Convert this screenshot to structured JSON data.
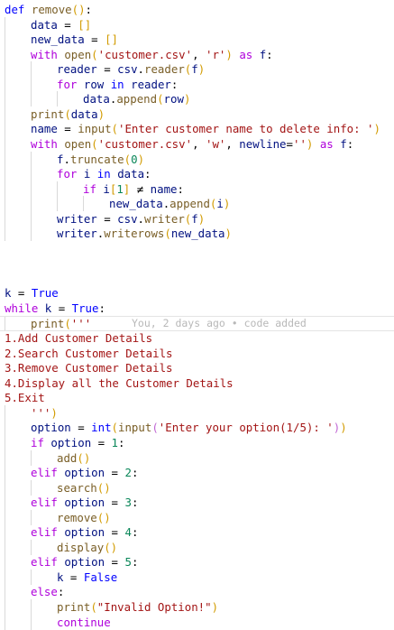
{
  "editor": {
    "blame_text": "You, 2 days ago • code added",
    "lines": [
      {
        "indent": 0,
        "tokens": [
          [
            "kw",
            "def"
          ],
          [
            "op",
            " "
          ],
          [
            "fn",
            "remove"
          ],
          [
            "br1",
            "()"
          ],
          [
            "op",
            ":"
          ]
        ]
      },
      {
        "indent": 1,
        "tokens": [
          [
            "var",
            "data"
          ],
          [
            "op",
            " = "
          ],
          [
            "br1",
            "[]"
          ]
        ]
      },
      {
        "indent": 1,
        "tokens": [
          [
            "var",
            "new_data"
          ],
          [
            "op",
            " = "
          ],
          [
            "br1",
            "[]"
          ]
        ]
      },
      {
        "indent": 1,
        "tokens": [
          [
            "ctl",
            "with"
          ],
          [
            "op",
            " "
          ],
          [
            "fn",
            "open"
          ],
          [
            "br1",
            "("
          ],
          [
            "str",
            "'customer.csv'"
          ],
          [
            "op",
            ", "
          ],
          [
            "str",
            "'r'"
          ],
          [
            "br1",
            ")"
          ],
          [
            "op",
            " "
          ],
          [
            "ctl",
            "as"
          ],
          [
            "op",
            " "
          ],
          [
            "var",
            "f"
          ],
          [
            "op",
            ":"
          ]
        ]
      },
      {
        "indent": 2,
        "tokens": [
          [
            "var",
            "reader"
          ],
          [
            "op",
            " = "
          ],
          [
            "var",
            "csv"
          ],
          [
            "op",
            "."
          ],
          [
            "fn",
            "reader"
          ],
          [
            "br1",
            "("
          ],
          [
            "var",
            "f"
          ],
          [
            "br1",
            ")"
          ]
        ]
      },
      {
        "indent": 2,
        "tokens": [
          [
            "ctl",
            "for"
          ],
          [
            "op",
            " "
          ],
          [
            "var",
            "row"
          ],
          [
            "op",
            " "
          ],
          [
            "kw",
            "in"
          ],
          [
            "op",
            " "
          ],
          [
            "var",
            "reader"
          ],
          [
            "op",
            ":"
          ]
        ]
      },
      {
        "indent": 3,
        "tokens": [
          [
            "var",
            "data"
          ],
          [
            "op",
            "."
          ],
          [
            "fn",
            "append"
          ],
          [
            "br1",
            "("
          ],
          [
            "var",
            "row"
          ],
          [
            "br1",
            ")"
          ]
        ]
      },
      {
        "indent": 1,
        "tokens": [
          [
            "fn",
            "print"
          ],
          [
            "br1",
            "("
          ],
          [
            "var",
            "data"
          ],
          [
            "br1",
            ")"
          ]
        ]
      },
      {
        "indent": 1,
        "tokens": [
          [
            "var",
            "name"
          ],
          [
            "op",
            " = "
          ],
          [
            "fn",
            "input"
          ],
          [
            "br1",
            "("
          ],
          [
            "str",
            "'Enter customer name to delete info: '"
          ],
          [
            "br1",
            ")"
          ]
        ]
      },
      {
        "indent": 1,
        "tokens": [
          [
            "ctl",
            "with"
          ],
          [
            "op",
            " "
          ],
          [
            "fn",
            "open"
          ],
          [
            "br1",
            "("
          ],
          [
            "str",
            "'customer.csv'"
          ],
          [
            "op",
            ", "
          ],
          [
            "str",
            "'w'"
          ],
          [
            "op",
            ", "
          ],
          [
            "var",
            "newline"
          ],
          [
            "op",
            "="
          ],
          [
            "str",
            "''"
          ],
          [
            "br1",
            ")"
          ],
          [
            "op",
            " "
          ],
          [
            "ctl",
            "as"
          ],
          [
            "op",
            " "
          ],
          [
            "var",
            "f"
          ],
          [
            "op",
            ":"
          ]
        ]
      },
      {
        "indent": 2,
        "tokens": [
          [
            "var",
            "f"
          ],
          [
            "op",
            "."
          ],
          [
            "fn",
            "truncate"
          ],
          [
            "br1",
            "("
          ],
          [
            "num",
            "0"
          ],
          [
            "br1",
            ")"
          ]
        ]
      },
      {
        "indent": 2,
        "tokens": [
          [
            "ctl",
            "for"
          ],
          [
            "op",
            " "
          ],
          [
            "var",
            "i"
          ],
          [
            "op",
            " "
          ],
          [
            "kw",
            "in"
          ],
          [
            "op",
            " "
          ],
          [
            "var",
            "data"
          ],
          [
            "op",
            ":"
          ]
        ]
      },
      {
        "indent": 3,
        "tokens": [
          [
            "ctl",
            "if"
          ],
          [
            "op",
            " "
          ],
          [
            "var",
            "i"
          ],
          [
            "br1",
            "["
          ],
          [
            "num",
            "1"
          ],
          [
            "br1",
            "]"
          ],
          [
            "op",
            " ≠ "
          ],
          [
            "var",
            "name"
          ],
          [
            "op",
            ":"
          ]
        ]
      },
      {
        "indent": 4,
        "tokens": [
          [
            "var",
            "new_data"
          ],
          [
            "op",
            "."
          ],
          [
            "fn",
            "append"
          ],
          [
            "br1",
            "("
          ],
          [
            "var",
            "i"
          ],
          [
            "br1",
            ")"
          ]
        ]
      },
      {
        "indent": 2,
        "tokens": [
          [
            "var",
            "writer"
          ],
          [
            "op",
            " = "
          ],
          [
            "var",
            "csv"
          ],
          [
            "op",
            "."
          ],
          [
            "fn",
            "writer"
          ],
          [
            "br1",
            "("
          ],
          [
            "var",
            "f"
          ],
          [
            "br1",
            ")"
          ]
        ]
      },
      {
        "indent": 2,
        "tokens": [
          [
            "var",
            "writer"
          ],
          [
            "op",
            "."
          ],
          [
            "fn",
            "writerows"
          ],
          [
            "br1",
            "("
          ],
          [
            "var",
            "new_data"
          ],
          [
            "br1",
            ")"
          ]
        ]
      },
      {
        "indent": 0,
        "tokens": []
      },
      {
        "indent": 0,
        "tokens": []
      },
      {
        "indent": 0,
        "tokens": []
      },
      {
        "indent": 0,
        "tokens": [
          [
            "var",
            "k"
          ],
          [
            "op",
            " = "
          ],
          [
            "kw",
            "True"
          ]
        ]
      },
      {
        "indent": 0,
        "tokens": [
          [
            "ctl",
            "while"
          ],
          [
            "op",
            " "
          ],
          [
            "var",
            "k"
          ],
          [
            "op",
            " = "
          ],
          [
            "kw",
            "True"
          ],
          [
            "op",
            ":"
          ]
        ]
      },
      {
        "indent": 1,
        "current": true,
        "tokens": [
          [
            "fn",
            "print"
          ],
          [
            "br1",
            "("
          ],
          [
            "str",
            "'''"
          ]
        ]
      },
      {
        "indent": 0,
        "tokens": [
          [
            "txt",
            "1.Add Customer Details"
          ]
        ]
      },
      {
        "indent": 0,
        "tokens": [
          [
            "txt",
            "2.Search Customer Details"
          ]
        ]
      },
      {
        "indent": 0,
        "tokens": [
          [
            "txt",
            "3.Remove Customer Details"
          ]
        ]
      },
      {
        "indent": 0,
        "tokens": [
          [
            "txt",
            "4.Display all the Customer Details"
          ]
        ]
      },
      {
        "indent": 0,
        "tokens": [
          [
            "txt",
            "5.Exit"
          ]
        ]
      },
      {
        "indent": 1,
        "tokens": [
          [
            "str",
            "'''"
          ],
          [
            "br1",
            ")"
          ]
        ]
      },
      {
        "indent": 1,
        "tokens": [
          [
            "var",
            "option"
          ],
          [
            "op",
            " = "
          ],
          [
            "kw",
            "int"
          ],
          [
            "br1",
            "("
          ],
          [
            "fn",
            "input"
          ],
          [
            "br2",
            "("
          ],
          [
            "str",
            "'Enter your option(1/5): '"
          ],
          [
            "br2",
            ")"
          ],
          [
            "br1",
            ")"
          ]
        ]
      },
      {
        "indent": 1,
        "tokens": [
          [
            "ctl",
            "if"
          ],
          [
            "op",
            " "
          ],
          [
            "var",
            "option"
          ],
          [
            "op",
            " = "
          ],
          [
            "num",
            "1"
          ],
          [
            "op",
            ":"
          ]
        ]
      },
      {
        "indent": 2,
        "tokens": [
          [
            "fn",
            "add"
          ],
          [
            "br1",
            "()"
          ]
        ]
      },
      {
        "indent": 1,
        "tokens": [
          [
            "ctl",
            "elif"
          ],
          [
            "op",
            " "
          ],
          [
            "var",
            "option"
          ],
          [
            "op",
            " = "
          ],
          [
            "num",
            "2"
          ],
          [
            "op",
            ":"
          ]
        ]
      },
      {
        "indent": 2,
        "tokens": [
          [
            "fn",
            "search"
          ],
          [
            "br1",
            "()"
          ]
        ]
      },
      {
        "indent": 1,
        "tokens": [
          [
            "ctl",
            "elif"
          ],
          [
            "op",
            " "
          ],
          [
            "var",
            "option"
          ],
          [
            "op",
            " = "
          ],
          [
            "num",
            "3"
          ],
          [
            "op",
            ":"
          ]
        ]
      },
      {
        "indent": 2,
        "tokens": [
          [
            "fn",
            "remove"
          ],
          [
            "br1",
            "()"
          ]
        ]
      },
      {
        "indent": 1,
        "tokens": [
          [
            "ctl",
            "elif"
          ],
          [
            "op",
            " "
          ],
          [
            "var",
            "option"
          ],
          [
            "op",
            " = "
          ],
          [
            "num",
            "4"
          ],
          [
            "op",
            ":"
          ]
        ]
      },
      {
        "indent": 2,
        "tokens": [
          [
            "fn",
            "display"
          ],
          [
            "br1",
            "()"
          ]
        ]
      },
      {
        "indent": 1,
        "tokens": [
          [
            "ctl",
            "elif"
          ],
          [
            "op",
            " "
          ],
          [
            "var",
            "option"
          ],
          [
            "op",
            " = "
          ],
          [
            "num",
            "5"
          ],
          [
            "op",
            ":"
          ]
        ]
      },
      {
        "indent": 2,
        "tokens": [
          [
            "var",
            "k"
          ],
          [
            "op",
            " = "
          ],
          [
            "kw",
            "False"
          ]
        ]
      },
      {
        "indent": 1,
        "tokens": [
          [
            "ctl",
            "else"
          ],
          [
            "op",
            ":"
          ]
        ]
      },
      {
        "indent": 2,
        "tokens": [
          [
            "fn",
            "print"
          ],
          [
            "br1",
            "("
          ],
          [
            "str",
            "\"Invalid Option!\""
          ],
          [
            "br1",
            ")"
          ]
        ]
      },
      {
        "indent": 2,
        "tokens": [
          [
            "ctl",
            "continue"
          ]
        ]
      }
    ]
  }
}
